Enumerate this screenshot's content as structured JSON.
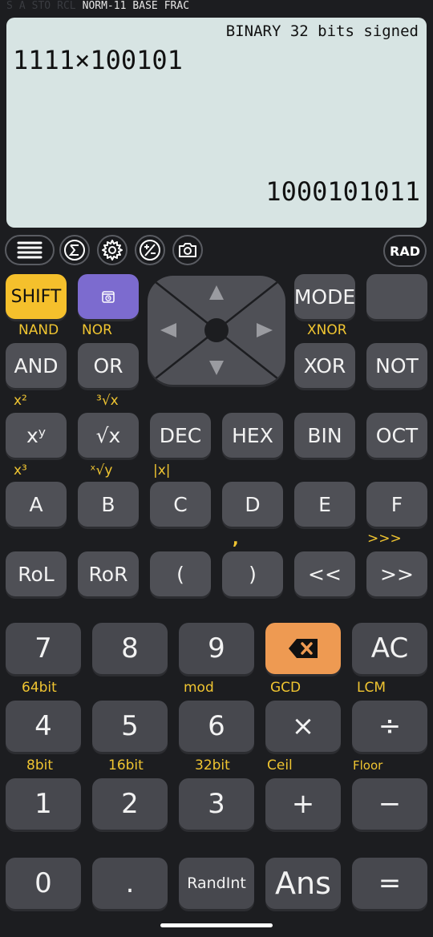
{
  "status": {
    "indicators_off": [
      "S",
      "A",
      "STO",
      "RCL"
    ],
    "indicators_on": [
      "NORM-11",
      "BASE",
      "FRAC"
    ]
  },
  "display": {
    "mode": "BINARY 32 bits signed",
    "expression": "1111×100101",
    "result": "1000101011"
  },
  "toolbar": {
    "icons": [
      "menu-icon",
      "sigma-icon",
      "settings-icon",
      "plus-minus-icon",
      "camera-icon"
    ],
    "angle_mode": "RAD"
  },
  "keys": {
    "row1": {
      "shift": "SHIFT",
      "mode": "MODE",
      "blank": ""
    },
    "row1_labels": {
      "shift": "NAND",
      "purple": "NOR",
      "mode": "XNOR"
    },
    "row2": [
      "AND",
      "OR",
      "XOR",
      "NOT"
    ],
    "row3_labels": {
      "xy": "x²",
      "sqrt": "³√x"
    },
    "row3": [
      "xʸ",
      "√x",
      "DEC",
      "HEX",
      "BIN",
      "OCT"
    ],
    "row4_labels": {
      "a": "x³",
      "b": "ˣ√y",
      "c": "|x|"
    },
    "row4": [
      "A",
      "B",
      "C",
      "D",
      "E",
      "F"
    ],
    "row5_labels": {
      "rparen": ",",
      "shr": ">>>"
    },
    "row5": [
      "RoL",
      "RoR",
      "(",
      ")",
      "<<",
      ">>"
    ],
    "num_row1": [
      "7",
      "8",
      "9",
      "AC"
    ],
    "num_row2_labels": [
      "64bit",
      "mod",
      "GCD",
      "LCM"
    ],
    "num_row2": [
      "4",
      "5",
      "6",
      "×",
      "÷"
    ],
    "num_row3_labels": [
      "8bit",
      "16bit",
      "32bit",
      "Ceil",
      "Floor"
    ],
    "num_row3": [
      "1",
      "2",
      "3",
      "+",
      "−"
    ],
    "num_row4": [
      "0",
      ".",
      "RandInt",
      "Ans",
      "="
    ]
  },
  "colors": {
    "display_bg": "#d7e4e3",
    "shift": "#f5c02c",
    "purple": "#7c6bcf",
    "orange": "#ee9a52",
    "label_yellow": "#f0c531"
  }
}
